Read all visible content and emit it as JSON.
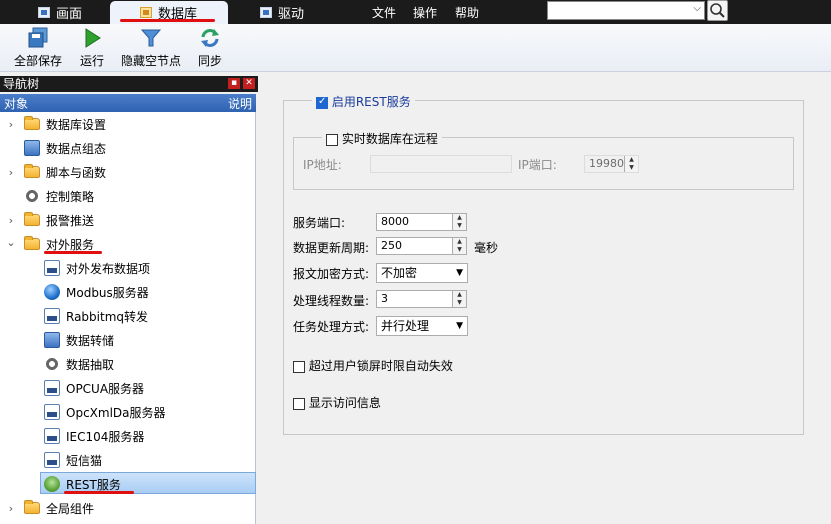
{
  "menubar": {
    "tabs": [
      {
        "label": "画面",
        "icon": "screen-icon"
      },
      {
        "label": "数据库",
        "icon": "database-icon",
        "active": true
      },
      {
        "label": "驱动",
        "icon": "driver-icon"
      }
    ],
    "menus": [
      "文件",
      "操作",
      "帮助"
    ],
    "search_value": ""
  },
  "toolbar": {
    "buttons": [
      {
        "label": "全部保存",
        "icon": "save-all-icon"
      },
      {
        "label": "运行",
        "icon": "run-icon"
      },
      {
        "label": "隐藏空节点",
        "icon": "filter-icon"
      },
      {
        "label": "同步",
        "icon": "sync-icon"
      }
    ]
  },
  "nav": {
    "title": "导航树",
    "header_left": "对象",
    "header_right": "说明",
    "items": [
      {
        "label": "数据库设置",
        "icon": "folder-icon"
      },
      {
        "label": "数据点组态",
        "icon": "points-icon"
      },
      {
        "label": "脚本与函数",
        "icon": "folder-icon"
      },
      {
        "label": "控制策略",
        "icon": "gear-icon"
      },
      {
        "label": "报警推送",
        "icon": "folder-icon"
      },
      {
        "label": "对外服务",
        "icon": "folder-open-icon"
      },
      {
        "label": "对外发布数据项",
        "icon": "publish-icon"
      },
      {
        "label": "Modbus服务器",
        "icon": "globe-icon"
      },
      {
        "label": "Rabbitmq转发",
        "icon": "forward-icon"
      },
      {
        "label": "数据转储",
        "icon": "storage-icon"
      },
      {
        "label": "数据抽取",
        "icon": "extract-icon"
      },
      {
        "label": "OPCUA服务器",
        "icon": "opcua-icon"
      },
      {
        "label": "OpcXmlDa服务器",
        "icon": "opcxml-icon"
      },
      {
        "label": "IEC104服务器",
        "icon": "iec104-icon"
      },
      {
        "label": "短信猫",
        "icon": "sms-icon"
      },
      {
        "label": "REST服务",
        "icon": "rest-api-icon",
        "selected": true
      },
      {
        "label": "全局组件",
        "icon": "folder-icon"
      }
    ]
  },
  "rest": {
    "enable_label": "启用REST服务",
    "enable_checked": true,
    "remote_label": "实时数据库在远程",
    "remote_checked": false,
    "ip_label": "IP地址:",
    "ip_value": "",
    "ip_port_label": "IP端口:",
    "ip_port_value": "19980",
    "service_port_label": "服务端口:",
    "service_port_value": "8000",
    "update_period_label": "数据更新周期:",
    "update_period_value": "250",
    "update_period_unit": "毫秒",
    "encryption_label": "报文加密方式:",
    "encryption_value": "不加密",
    "threads_label": "处理线程数量:",
    "threads_value": "3",
    "task_mode_label": "任务处理方式:",
    "task_mode_value": "并行处理",
    "lock_expire_label": "超过用户锁屏时限自动失效",
    "lock_expire_checked": false,
    "show_access_label": "显示访问信息",
    "show_access_checked": false
  }
}
